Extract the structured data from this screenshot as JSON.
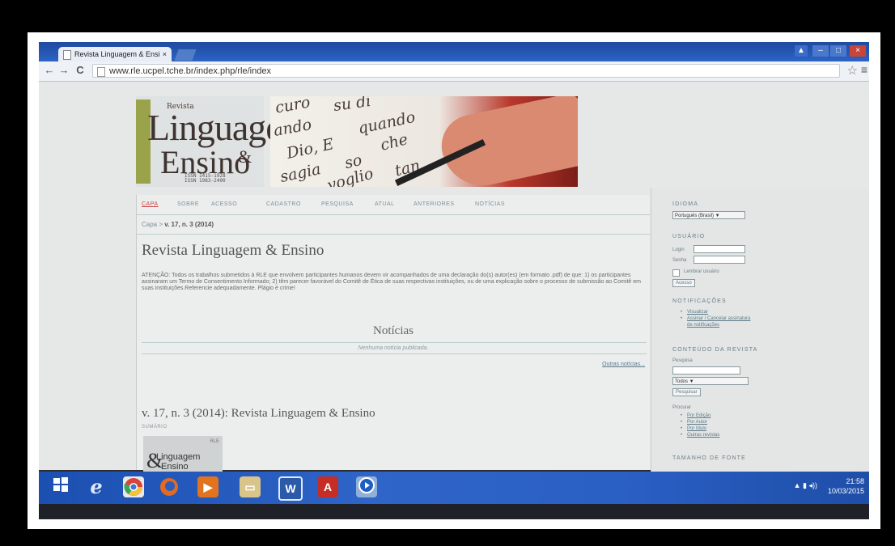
{
  "browser": {
    "tab_title": "Revista Linguagem & Ensi",
    "tab_close": "×",
    "url": "www.rle.ucpel.tche.br/index.php/rle/index",
    "back": "←",
    "forward": "→",
    "reload": "C",
    "star": "☆",
    "menu": "≡",
    "window_user": "▲",
    "window_min": "–",
    "window_max": "□",
    "window_close": "×"
  },
  "header": {
    "logo": {
      "revista": "Revista",
      "linguagem": "Linguagem",
      "ensino": "Ensino",
      "amp": "&",
      "issn1": "ISSN 1415-1928",
      "issn2": "ISSN 1983-2400"
    },
    "banner_words": [
      "curo",
      "su di",
      "ando",
      "quando",
      "che",
      "Dio, E",
      "sagia",
      "so",
      "voglio",
      "tan"
    ]
  },
  "nav": {
    "items": [
      "CAPA",
      "SOBRE",
      "ACESSO",
      "CADASTRO",
      "PESQUISA",
      "ATUAL",
      "ANTERIORES",
      "NOTÍCIAS"
    ]
  },
  "breadcrumb": {
    "home": "Capa",
    "separator": " > ",
    "current": "v. 17, n. 3 (2014)"
  },
  "main": {
    "title": "Revista Linguagem & Ensino",
    "notice": "ATENÇÃO: Todos os trabalhos submetidos à RLE que envolvem participantes humanos devem vir acompanhados de uma declaração do(s) autor(es) (em formato .pdf) de que: 1) os participantes assinaram um Termo de Consentimento Informado; 2) têm parecer favorável do Comitê de Ética de suas respectivas instituições, ou de uma explicação sobre o processo de submissão ao Comitê em suas instituições.Referencie adequadamente. Plágio é crime!",
    "news_title": "Notícias",
    "news_empty": "Nenhuma notícia publicada.",
    "more_news": "Outras notícias...",
    "issue_title": "v. 17, n. 3 (2014): Revista Linguagem & Ensino",
    "sumario": "SUMÁRIO",
    "cover_amp": "&",
    "cover_text": "Linguagem",
    "cover_text2": "Ensino",
    "cover_corner": "RLE"
  },
  "sidebar": {
    "idioma_head": "IDIOMA",
    "idioma_value": "Português (Brasil) ▼",
    "usuario_head": "USUÁRIO",
    "login_label": "Login",
    "senha_label": "Senha",
    "lembrar": "Lembrar usuário",
    "acesso_btn": "Acesso",
    "notif_head": "NOTIFICAÇÕES",
    "visualizar": "Visualizar",
    "assinar": "Assinar / Cancelar assinatura",
    "assinar2": "de notificações",
    "conteudo_head": "CONTEÚDO DA REVISTA",
    "pesquisa_label": "Pesquisa",
    "todos_value": "Todos ▼",
    "pesquisar_btn": "Pesquisar",
    "procurar_label": "Procurar",
    "por_edicao": "Por Edição",
    "por_autor": "Por Autor",
    "por_titulo": "Por título",
    "outras_revistas": "Outras revistas",
    "fonte_head": "TAMANHO DE FONTE"
  },
  "taskbar": {
    "icons": [
      "windows-logo",
      "internet-explorer",
      "chrome",
      "firefox",
      "media",
      "file-explorer",
      "word",
      "acrobat",
      "media-player"
    ],
    "word_letter": "W",
    "acrobat_letter": "A",
    "ie_letter": "e",
    "clock_time": "21:58",
    "clock_date": "10/03/2015",
    "tray": "▲ ▮ ◂))"
  }
}
